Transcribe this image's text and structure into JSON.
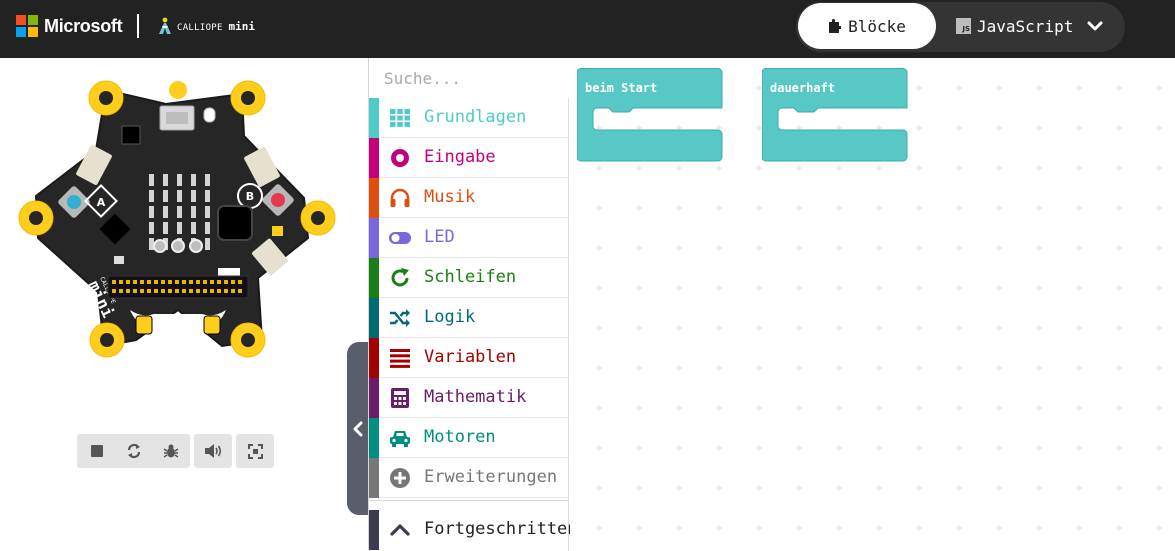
{
  "header": {
    "brand": "Microsoft",
    "product_small": "CALLIOPE",
    "product_big": "mini",
    "mode_blocks": "Blöcke",
    "mode_js": "JavaScript",
    "js_badge": "JS"
  },
  "simulator": {
    "board_labels": {
      "button_a": "A",
      "button_b": "B",
      "brand_small": "CALLIOPE",
      "brand_big": "mini"
    },
    "toolbar": [
      {
        "name": "stop",
        "icon": "stop-icon"
      },
      {
        "name": "restart",
        "icon": "restart-icon"
      },
      {
        "name": "debug",
        "icon": "bug-icon"
      },
      {
        "name": "mute",
        "icon": "speaker-icon"
      },
      {
        "name": "fullscreen",
        "icon": "fullscreen-icon"
      }
    ]
  },
  "toolbox": {
    "search_placeholder": "Suche...",
    "categories": [
      {
        "label": "Grundlagen",
        "color": "#1e90ff",
        "icon": "grid-icon"
      },
      {
        "label": "Eingabe",
        "color": "#d400d4",
        "icon": "circle-dot-icon"
      },
      {
        "label": "Musik",
        "color": "#e63022",
        "icon": "headphones-icon"
      },
      {
        "label": "LED",
        "color": "#5c2d91",
        "icon": "toggle-icon"
      },
      {
        "label": "Schleifen",
        "color": "#00aa00",
        "icon": "refresh-icon"
      },
      {
        "label": "Logik",
        "color": "#00a4a6",
        "icon": "shuffle-icon"
      },
      {
        "label": "Variablen",
        "color": "#dc143c",
        "icon": "list-icon"
      },
      {
        "label": "Mathematik",
        "color": "#9400d3",
        "icon": "calculator-icon"
      },
      {
        "label": "Motoren",
        "color": "#00a0a0",
        "icon": "car-icon"
      },
      {
        "label": "Erweiterungen",
        "color": "#7f7f7f",
        "icon": "plus-circle-icon"
      }
    ],
    "advanced_label": "Fortgeschritten"
  },
  "workspace": {
    "blocks": [
      {
        "label": "beim Start"
      },
      {
        "label": "dauerhaft"
      }
    ]
  },
  "colors": {
    "header_bg": "#222222",
    "block": "#57c8c6",
    "block_border": "#3eaaa8",
    "grundlagen": "#4ecbc9",
    "eingabe": "#c5007b",
    "musik": "#de4f10",
    "led": "#7c66dd",
    "schleifen": "#1b7f17",
    "logik": "#046a73",
    "variablen": "#a30000",
    "mathematik": "#6a1b69",
    "motoren": "#008e80",
    "erweiterungen": "#777777",
    "fortgeschritten": "#3b3c4f"
  }
}
